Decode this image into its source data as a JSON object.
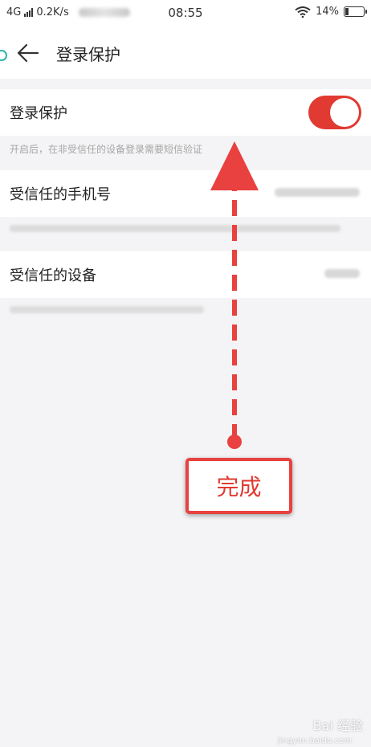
{
  "status_bar": {
    "network": "4G",
    "speed": "0.2K/s",
    "time": "08:55",
    "battery": "14%"
  },
  "header": {
    "title": "登录保护"
  },
  "settings": {
    "login_protection": {
      "label": "登录保护",
      "enabled": true,
      "description": "开启后，在非受信任的设备登录需要短信验证"
    },
    "trusted_phone": {
      "label": "受信任的手机号"
    },
    "trusted_devices": {
      "label": "受信任的设备"
    }
  },
  "annotation": {
    "text": "完成",
    "color": "#e03a32"
  },
  "watermark": {
    "line1": "Bai 经验",
    "line2": "jingyan.baidu.com"
  },
  "colors": {
    "toggle_on": "#e03a32",
    "background": "#f4f4f6"
  }
}
